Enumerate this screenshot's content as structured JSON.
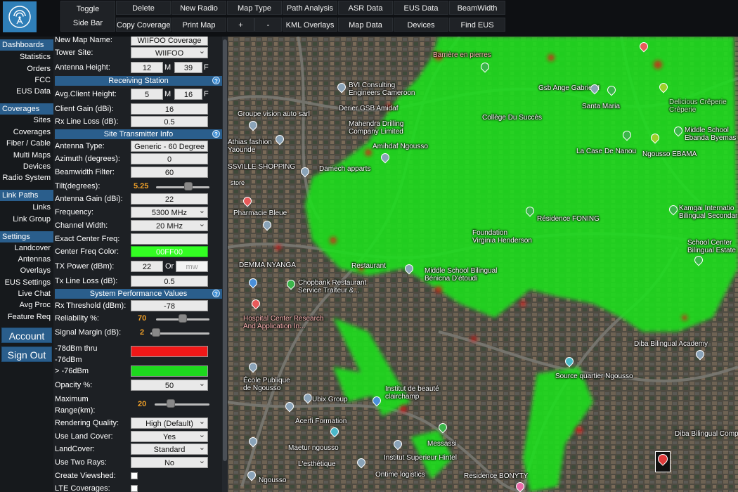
{
  "toolbar": {
    "toggle_line1": "Toggle",
    "toggle_line2": "Side Bar",
    "row1": [
      "Delete",
      "New Radio",
      "Map Type",
      "Path Analysis",
      "ASR Data",
      "EUS Data",
      "BeamWidth"
    ],
    "row2": [
      "Copy Coverage",
      "Print Map",
      "+",
      "-",
      "KML Overlays",
      "Map Data",
      "Devices",
      "Find EUS"
    ]
  },
  "sidebar": {
    "dashboards": "Dashboards",
    "group1": [
      "Statistics",
      "Orders",
      "FCC",
      "EUS Data"
    ],
    "coverages": "Coverages",
    "group2": [
      "Sites",
      "Coverages",
      "Fiber / Cable",
      "Multi Maps",
      "Devices",
      "Radio System"
    ],
    "link_paths": "Link Paths",
    "group3": [
      "Links",
      "Link Group"
    ],
    "settings": "Settings",
    "group4": [
      "Landcover",
      "Antennas",
      "Overlays",
      "EUS Settings",
      "Live Chat",
      "Avg Proc",
      "Feature Req"
    ],
    "account": "Account",
    "sign_out": "Sign Out"
  },
  "form": {
    "new_map_name_label": "New Map Name:",
    "new_map_name_value": "WIIFOO Coverage",
    "tower_site_label": "Tower Site:",
    "tower_site_value": "WIIFOO",
    "antenna_height_label": "Antenna Height:",
    "antenna_height_m": "12",
    "antenna_height_f": "39",
    "unit_m": "M",
    "unit_f": "F",
    "receiving_station_title": "Receiving Station",
    "avg_client_height_label": "Avg.Client Height:",
    "avg_client_height_m": "5",
    "avg_client_height_f": "16",
    "client_gain_label": "Client Gain (dBi):",
    "client_gain_value": "16",
    "rx_line_loss_label": "Rx Line Loss (dB):",
    "rx_line_loss_value": "0.5",
    "site_transmitter_title": "Site Transmitter Info",
    "antenna_type_label": "Antenna Type:",
    "antenna_type_value": "Generic - 60 Degree",
    "azimuth_label": "Azimuth (degrees):",
    "azimuth_value": "0",
    "beamwidth_label": "Beamwidth Filter:",
    "beamwidth_value": "60",
    "tilt_label": "Tilt(degrees):",
    "tilt_value": "5.25",
    "tilt_level": 0.62,
    "antenna_gain_label": "Antenna Gain (dBi):",
    "antenna_gain_value": "22",
    "frequency_label": "Frequency:",
    "frequency_value": "5300 MHz",
    "channel_width_label": "Channel Width:",
    "channel_width_value": "20 MHz",
    "exact_center_label": "Exact Center Freq:",
    "exact_center_value": "",
    "center_color_label": "Center Freq Color:",
    "center_color_value": "00FF00",
    "center_color_hex": "#33ff22",
    "tx_power_label": "TX Power (dBm):",
    "tx_power_value": "22",
    "tx_or": "Or",
    "tx_mw_placeholder": "mw",
    "tx_line_loss_label": "Tx Line Loss (dB):",
    "tx_line_loss_value": "0.5",
    "system_perf_title": "System Performance Values",
    "rx_threshold_label": "Rx Threshold (dBm):",
    "rx_threshold_value": "-78",
    "reliability_label": "Reliability %:",
    "reliability_value": "70",
    "reliability_level": 0.5,
    "signal_margin_label": "Signal Margin (dB):",
    "signal_margin_value": "2",
    "signal_margin_level": 0.03,
    "band1_label_line1": "-78dBm thru",
    "band1_label_line2": "-76dBm",
    "band1_color": "#f01818",
    "band2_label": "> -76dBm",
    "band2_color": "#1ed81e",
    "opacity_label": "Opacity %:",
    "opacity_value": "50",
    "max_range_label_line1": "Maximum",
    "max_range_label_line2": "Range(km):",
    "max_range_value": "20",
    "max_range_level": 0.25,
    "rendering_label": "Rendering Quality:",
    "rendering_value": "High (Default)",
    "land_cover_label": "Use Land Cover:",
    "land_cover_value": "Yes",
    "landcover_label": "LandCover:",
    "landcover_value": "Standard",
    "two_rays_label": "Use Two Rays:",
    "two_rays_value": "No",
    "viewshed_label": "Create Viewshed:",
    "lte_label": "LTE Coverages:"
  },
  "map": {
    "labels": {
      "barriere": "Barrière en pierres",
      "bvi": "BVI Consulting\nEngineers Cameroon",
      "gsb": "Gsb Ange Gabriel II",
      "creperie": "Delicious Crêperie\nCrêperie",
      "groupe": "Groupe vision auto sarl",
      "derier": "Derier GSB Amidaf",
      "santa": "Santa Maria",
      "college": "Collège Du Succès",
      "mahendra": "Mahendra Drilling\nCompany Limited",
      "middle1": "Middle School\nEbanda Byemas",
      "athias": "Athias fashion\nYaounde",
      "amihdaf": "Amihdaf Ngousso",
      "casede": "La Case De Nanou",
      "ebama": "Ngousso EBAMA",
      "damech": "Damech apparts",
      "ssville": "SSVILLE SHOPPING",
      "store": "store",
      "pharmacie": "Pharmacie Bleue",
      "kamgai": "Kamgai Internatio\nBilingual Secondar",
      "residence": "Résidence FONING",
      "foundation": "Foundation\nVirginia Henderson",
      "school_center": "School Center\nBilingual Estate",
      "demma": "DEMMA NYANGA",
      "restaurant": "Restaurant",
      "middle_bil": "Middle School Bilingual\nBénicna D'étoudi",
      "chopbank": "Chopbank Restaurant\nService Traiteur &...",
      "hospital": "Hospital Center Research\nAnd Application In...",
      "diba": "Diba Bilingual Academy",
      "source": "Source quartier Ngousso",
      "ecole": "École Publique\nde Ngousso",
      "institut": "Institut de beauté\nclairchamp",
      "ubix": "Ubix Group",
      "acerfi": "Acerfi Formation",
      "messassi": "Messassi",
      "maetur": "Maetur ngousso",
      "diba2": "Diba Bilingual Comple",
      "esthetique": "L'esthétique",
      "institut_sup": "Institut Superieur Hintel",
      "ntime": "Ontime logistics",
      "ngousso": "Ngousso",
      "bonyty": "Residence BONYTY"
    }
  }
}
